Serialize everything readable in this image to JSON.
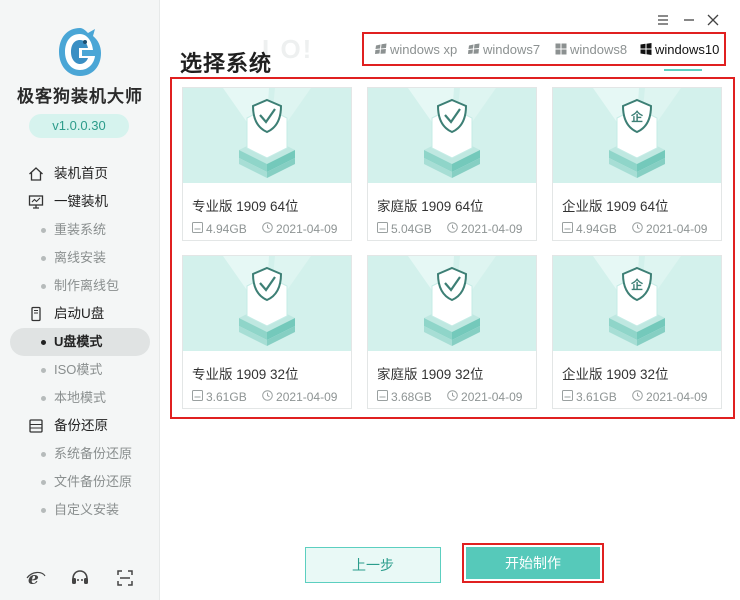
{
  "app": {
    "name": "极客狗装机大师",
    "version": "v1.0.0.30",
    "colors": {
      "accent": "#56c9ba",
      "accent_light": "#d6f3ee",
      "highlight_border": "#e02020"
    }
  },
  "sidebar": {
    "items": [
      {
        "label": "装机首页",
        "type": "group",
        "icon": "home-icon"
      },
      {
        "label": "一键装机",
        "type": "group",
        "icon": "monitor-icon"
      },
      {
        "label": "重装系统",
        "type": "sub"
      },
      {
        "label": "离线安装",
        "type": "sub"
      },
      {
        "label": "制作离线包",
        "type": "sub"
      },
      {
        "label": "启动U盘",
        "type": "group",
        "icon": "usb-icon"
      },
      {
        "label": "U盘模式",
        "type": "sub",
        "active": true
      },
      {
        "label": "ISO模式",
        "type": "sub"
      },
      {
        "label": "本地模式",
        "type": "sub"
      },
      {
        "label": "备份还原",
        "type": "group",
        "icon": "backup-icon"
      },
      {
        "label": "系统备份还原",
        "type": "sub"
      },
      {
        "label": "文件备份还原",
        "type": "sub"
      },
      {
        "label": "自定义安装",
        "type": "sub"
      }
    ],
    "bottom_icons": [
      "browser-icon",
      "chat-icon",
      "scan-icon"
    ]
  },
  "window_controls": [
    "menu-icon",
    "minimize-icon",
    "close-icon"
  ],
  "main": {
    "title": "选择系统",
    "title_ghost": "I  O!",
    "tabs": [
      {
        "label": "windows xp",
        "icon": "windows-xp-icon"
      },
      {
        "label": "windows7",
        "icon": "windows7-icon"
      },
      {
        "label": "windows8",
        "icon": "windows8-icon"
      },
      {
        "label": "windows10",
        "icon": "windows10-icon",
        "active": true
      }
    ],
    "cards": [
      {
        "name": "专业版 1909 64位",
        "size": "4.94GB",
        "date": "2021-04-09",
        "emblem": "check"
      },
      {
        "name": "家庭版 1909 64位",
        "size": "5.04GB",
        "date": "2021-04-09",
        "emblem": "check"
      },
      {
        "name": "企业版 1909 64位",
        "size": "4.94GB",
        "date": "2021-04-09",
        "emblem": "企"
      },
      {
        "name": "专业版 1909 32位",
        "size": "3.61GB",
        "date": "2021-04-09",
        "emblem": "check"
      },
      {
        "name": "家庭版 1909 32位",
        "size": "3.68GB",
        "date": "2021-04-09",
        "emblem": "check"
      },
      {
        "name": "企业版 1909 32位",
        "size": "3.61GB",
        "date": "2021-04-09",
        "emblem": "企"
      }
    ]
  },
  "footer": {
    "prev_label": "上一步",
    "start_label": "开始制作"
  }
}
